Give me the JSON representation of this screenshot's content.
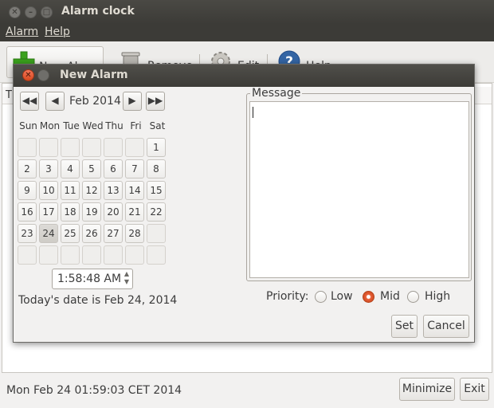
{
  "window": {
    "title": "Alarm clock"
  },
  "menu": {
    "alarm": "Alarm",
    "help": "Help"
  },
  "toolbar": {
    "new_alarm": "New Alarm",
    "remove": "Remove",
    "edit": "Edit",
    "help": "Help"
  },
  "table": {
    "header_first_char": "T"
  },
  "status": {
    "datetime": "Mon Feb 24 01:59:03 CET 2014"
  },
  "buttons": {
    "minimize": "Minimize",
    "exit": "Exit"
  },
  "dialog": {
    "title": "New Alarm",
    "month": "Feb 2014",
    "weekdays": [
      "Sun",
      "Mon",
      "Tue",
      "Wed",
      "Thu",
      "Fri",
      "Sat"
    ],
    "selected_day": "24",
    "weeks": [
      [
        "",
        "",
        "",
        "",
        "",
        "",
        "1"
      ],
      [
        "2",
        "3",
        "4",
        "5",
        "6",
        "7",
        "8"
      ],
      [
        "9",
        "10",
        "11",
        "12",
        "13",
        "14",
        "15"
      ],
      [
        "16",
        "17",
        "18",
        "19",
        "20",
        "21",
        "22"
      ],
      [
        "23",
        "24",
        "25",
        "26",
        "27",
        "28",
        ""
      ],
      [
        "",
        "",
        "",
        "",
        "",
        "",
        ""
      ]
    ],
    "time": "1:58:48 AM",
    "today_text": "Today's date is Feb 24, 2014",
    "message_label": "Message",
    "message_value": "",
    "priority_label": "Priority:",
    "priority_options": [
      "Low",
      "Mid",
      "High"
    ],
    "priority_selected": "Mid",
    "set_button": "Set",
    "cancel_button": "Cancel"
  },
  "colors": {
    "titlebar": "#3c3b37",
    "accent": "#e9623a",
    "close_button": "#d7491e",
    "new_icon": "#3aa11c",
    "help_icon": "#3465a4"
  }
}
